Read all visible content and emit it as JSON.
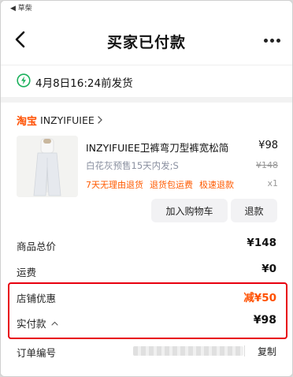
{
  "status_bar": {
    "back_app": "◀ 草柴"
  },
  "nav": {
    "title": "买家已付款",
    "back_icon": "chevron-left-icon",
    "more_icon": "more-dots-icon"
  },
  "shipping": {
    "text": "4月8日16:24前发货",
    "icon": "lightning-circle-icon",
    "accent": "#19b05a"
  },
  "shop": {
    "platform": "淘宝",
    "name": "INZYIFUIEE",
    "platform_color": "#ff5000"
  },
  "product": {
    "title": "INZYIFUIEE卫裤弯刀型裤宽松简",
    "price": "¥98",
    "spec": "白花灰预售15天内发;S",
    "original_price": "¥148",
    "tags": [
      "7天无理由退货",
      "退货包运费",
      "极速退款"
    ],
    "quantity": "x1"
  },
  "buttons": {
    "add_to_cart": "加入购物车",
    "refund": "退款"
  },
  "summary": {
    "total_label": "商品总价",
    "total_value": "¥148",
    "shipping_label": "运费",
    "shipping_value": "¥0",
    "discount_label": "店铺优惠",
    "discount_value": "减¥50",
    "paid_label": "实付款",
    "paid_value": "¥98"
  },
  "order": {
    "number_label": "订单编号",
    "copy_label": "复制"
  },
  "colors": {
    "highlight": "#e8000e",
    "accent_orange": "#ff5000"
  }
}
